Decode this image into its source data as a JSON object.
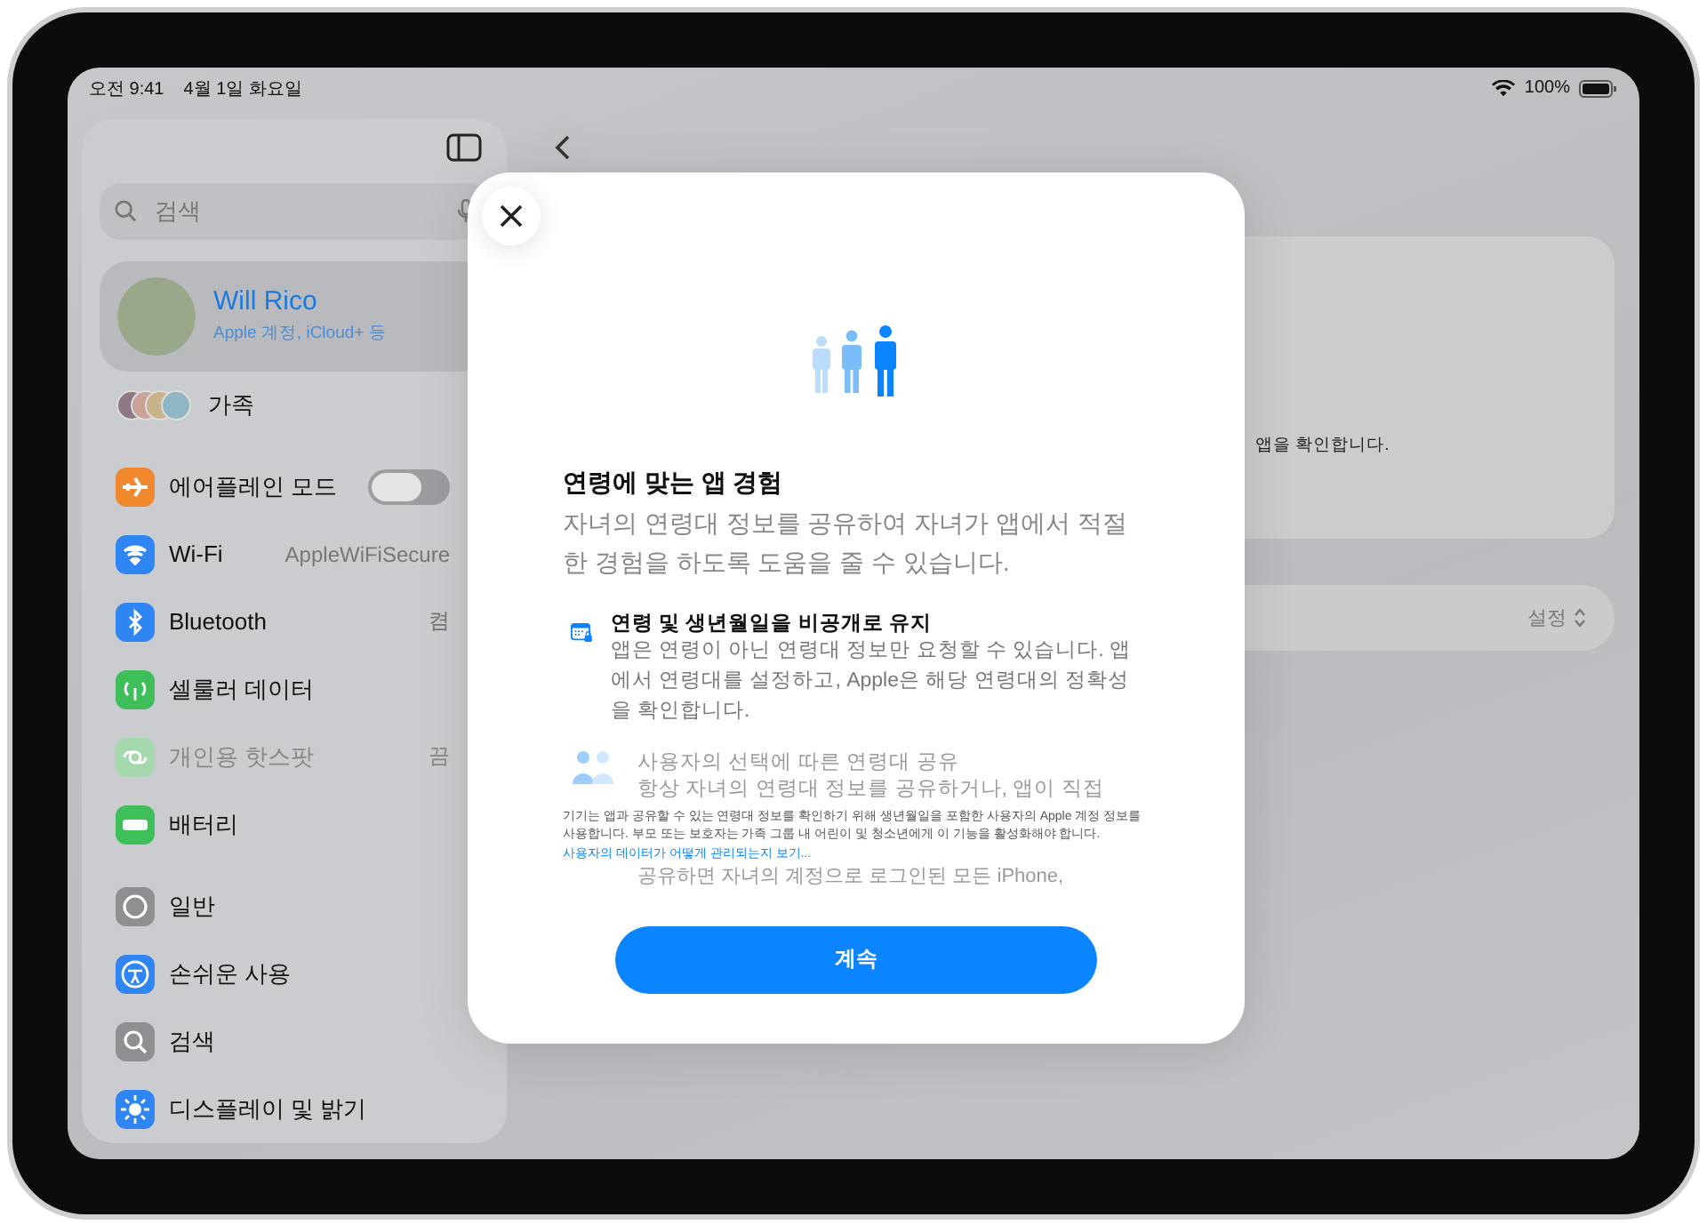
{
  "status_bar": {
    "time": "오전 9:41",
    "date": "4월 1일 화요일",
    "battery": "100%"
  },
  "sidebar": {
    "search": {
      "placeholder": "검색"
    },
    "account": {
      "name": "Will Rico",
      "subtitle": "Apple 계정, iCloud+ 등",
      "selected": true
    },
    "family": {
      "label": "가족"
    },
    "groups": [
      [
        {
          "kind": "toggle",
          "label": "에어플레인 모드",
          "color": "#f0892e",
          "on": false,
          "disabled": false
        },
        {
          "kind": "value",
          "label": "Wi-Fi",
          "value": "AppleWiFiSecure",
          "color": "#2f86f3",
          "disabled": false
        },
        {
          "kind": "value",
          "label": "Bluetooth",
          "value": "켬",
          "color": "#2f86f3",
          "disabled": false
        },
        {
          "kind": "plain",
          "label": "셀룰러 데이터",
          "color": "#3fbf5a",
          "disabled": false
        },
        {
          "kind": "value",
          "label": "개인용 핫스팟",
          "value": "끔",
          "color": "#a3d9ad",
          "disabled": true
        },
        {
          "kind": "plain",
          "label": "배터리",
          "color": "#3fbf5a",
          "disabled": false
        }
      ],
      [
        {
          "kind": "plain",
          "label": "일반",
          "color": "#8e8e93",
          "disabled": false
        },
        {
          "kind": "plain",
          "label": "손쉬운 사용",
          "color": "#2f86f3",
          "disabled": false
        },
        {
          "kind": "plain",
          "label": "검색",
          "color": "#8e8e93",
          "disabled": false
        },
        {
          "kind": "plain",
          "label": "디스플레이 및 밝기",
          "color": "#2f86f3",
          "disabled": false
        }
      ]
    ]
  },
  "detail": {
    "card_text": "앱을 확인합니다.",
    "row_value": "설정"
  },
  "modal": {
    "title": "연령에 맞는 앱 경험",
    "subtitle": "자녀의 연령대 정보를 공유하여 자녀가 앱에서 적절한 경험을 하도록 도움을 줄 수 있습니다.",
    "features": [
      {
        "kind": "calendar",
        "title": "연령 및 생년월일을 비공개로 유지",
        "text": "앱은 연령이 아닌 연령대 정보만 요청할 수 있습니다. 앱에서 연령대를 설정하고, Apple은 해당 연령대의 정확성을 확인합니다.",
        "faded": false
      },
      {
        "kind": "people",
        "title": "사용자의 선택에 따른 연령대 공유",
        "text": "항상 자녀의 연령대 정보를 공유하거나, 앱이 직접",
        "faded": true
      }
    ],
    "footnote": "기기는 앱과 공유할 수 있는 연령대 정보를 확인하기 위해 생년월일을 포함한 사용자의 Apple 계정 정보를 사용합니다. 부모 또는 보호자는 가족 그룹 내 어린이 및 청소년에게 이 기능을 활성화해야 합니다.",
    "link": "사용자의 데이터가 어떻게 관리되는지 보기...",
    "faded_line": "공유하면 자녀의 계정으로 로그인된 모든 iPhone,",
    "button": "계속"
  }
}
